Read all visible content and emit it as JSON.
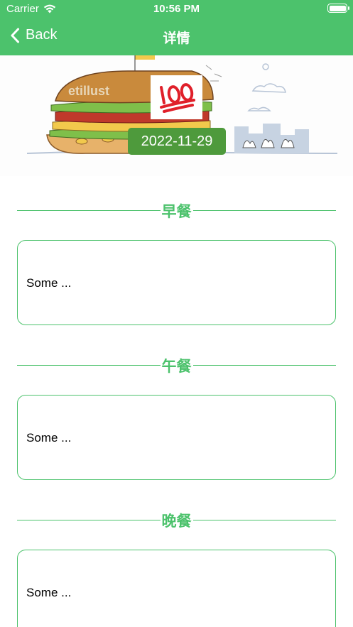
{
  "status_bar": {
    "carrier": "Carrier",
    "time": "10:56 PM"
  },
  "nav": {
    "back_label": "Back",
    "title": "详情"
  },
  "hero": {
    "date": "2022-11-29",
    "emoji": "💯"
  },
  "meals": [
    {
      "title": "早餐",
      "content": "Some ..."
    },
    {
      "title": "午餐",
      "content": "Some ..."
    },
    {
      "title": "晚餐",
      "content": "Some ..."
    }
  ],
  "colors": {
    "accent": "#4cc26c",
    "date_badge": "#4e9a3c"
  }
}
